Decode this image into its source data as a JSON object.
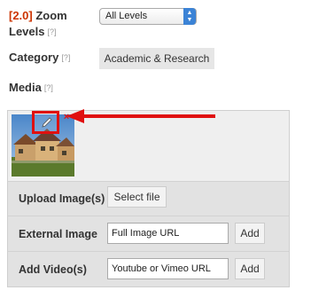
{
  "zoom": {
    "version_tag": "[2.0]",
    "label_line1": "Zoom",
    "label_line2": "Levels",
    "help": "[?]",
    "selected_value": "All Levels"
  },
  "category": {
    "label": "Category",
    "help": "[?]",
    "value": "Academic & Research"
  },
  "media": {
    "label": "Media",
    "help": "[?]",
    "remove_glyph": "×",
    "upload": {
      "label": "Upload Image(s)",
      "button": "Select file"
    },
    "external": {
      "label": "External Image",
      "placeholder": "Full Image URL",
      "button": "Add"
    },
    "video": {
      "label": "Add Video(s)",
      "placeholder": "Youtube or Vimeo URL",
      "button": "Add"
    }
  },
  "colors": {
    "highlight": "#e01010",
    "version_tag": "#cc3300",
    "select_arrow": "#3b83d6"
  },
  "icons": [
    "pencil-icon",
    "remove-icon",
    "pointer-arrow",
    "select-arrows-icon"
  ]
}
